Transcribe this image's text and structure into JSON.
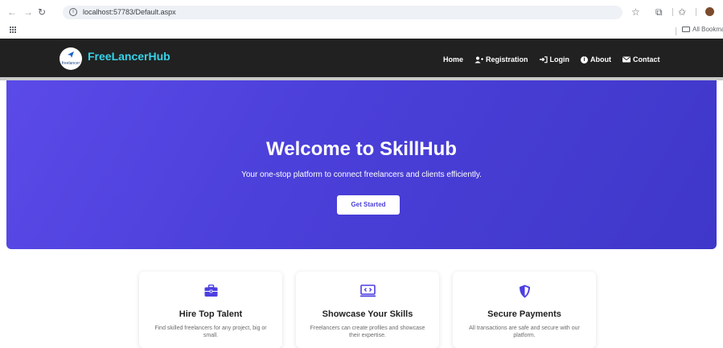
{
  "browser": {
    "url": "localhost:57783/Default.aspx",
    "bookmarks_label": "All Bookma"
  },
  "site": {
    "brand": "FreeLancerHub",
    "logo_caption": "freelancer",
    "nav": [
      {
        "label": "Home",
        "icon": "none"
      },
      {
        "label": "Registration",
        "icon": "user-plus-icon"
      },
      {
        "label": "Login",
        "icon": "sign-in-icon"
      },
      {
        "label": "About",
        "icon": "info-circle-icon"
      },
      {
        "label": "Contact",
        "icon": "envelope-icon"
      }
    ]
  },
  "hero": {
    "title": "Welcome to SkillHub",
    "subtitle": "Your one-stop platform to connect freelancers and clients efficiently.",
    "cta": "Get Started"
  },
  "features": [
    {
      "title": "Hire Top Talent",
      "description": "Find skilled freelancers for any project, big or small.",
      "icon": "briefcase-icon"
    },
    {
      "title": "Showcase Your Skills",
      "description": "Freelancers can create profiles and showcase their expertise.",
      "icon": "code-screen-icon"
    },
    {
      "title": "Secure Payments",
      "description": "All transactions are safe and secure with our platform.",
      "icon": "shield-icon"
    }
  ],
  "colors": {
    "navbar": "#212121",
    "brand": "#35d3ea",
    "hero": "#4a3fd8",
    "accent_icon": "#4c3fe0"
  }
}
